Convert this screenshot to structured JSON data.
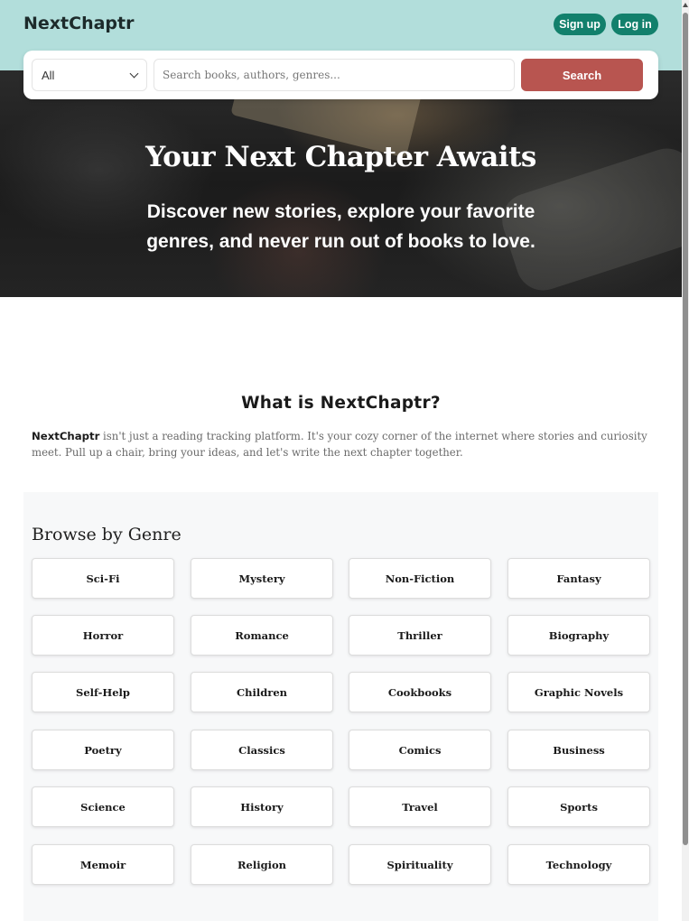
{
  "header": {
    "brand": "NextChaptr",
    "signup_label": "Sign up",
    "login_label": "Log in"
  },
  "search": {
    "category_selected": "All",
    "placeholder": "Search books, authors, genres...",
    "button_label": "Search"
  },
  "hero": {
    "title": "Your Next Chapter Awaits",
    "subtitle": "Discover new stories, explore your favorite genres, and never run out of books to love."
  },
  "about": {
    "title": "What is NextChaptr?",
    "brand_bold": "NextChaptr",
    "text": " isn't just a reading tracking platform. It's your cozy corner of the internet where stories and curiosity meet. Pull up a chair, bring your ideas, and let's write the next chapter together."
  },
  "genres": {
    "heading": "Browse by Genre",
    "items": [
      "Sci-Fi",
      "Mystery",
      "Non-Fiction",
      "Fantasy",
      "Horror",
      "Romance",
      "Thriller",
      "Biography",
      "Self-Help",
      "Children",
      "Cookbooks",
      "Graphic Novels",
      "Poetry",
      "Classics",
      "Comics",
      "Business",
      "Science",
      "History",
      "Travel",
      "Sports",
      "Memoir",
      "Religion",
      "Spirituality",
      "Technology"
    ]
  },
  "colors": {
    "header_bg": "#b2dedb",
    "auth_button": "#12806c",
    "search_button": "#b85550",
    "genre_bg": "#f7f8f9"
  }
}
